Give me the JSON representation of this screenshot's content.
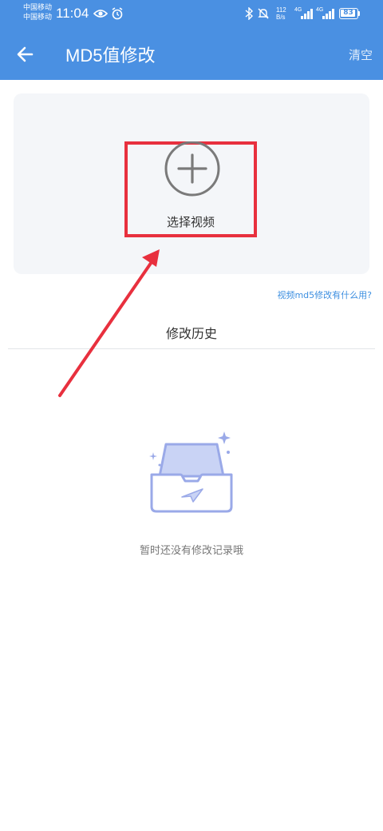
{
  "status_bar": {
    "carrier1": "中国移动",
    "carrier2": "中国移动",
    "time": "11:04",
    "net_speed_value": "112",
    "net_speed_unit": "B/s",
    "signal1_label": "4G",
    "signal2_label": "4G",
    "battery": "83"
  },
  "header": {
    "title": "MD5值修改",
    "clear_label": "清空",
    "back_icon": "back-arrow-icon"
  },
  "upload": {
    "select_label": "选择视频",
    "plus_icon": "plus-circle-icon"
  },
  "help_link": "视频md5修改有什么用?",
  "history": {
    "title": "修改历史",
    "empty_text": "暂时还没有修改记录哦",
    "empty_icon": "empty-inbox-icon"
  },
  "colors": {
    "header_bg": "#4a90e2",
    "highlight": "#e8303e",
    "link": "#3d8fe0"
  }
}
